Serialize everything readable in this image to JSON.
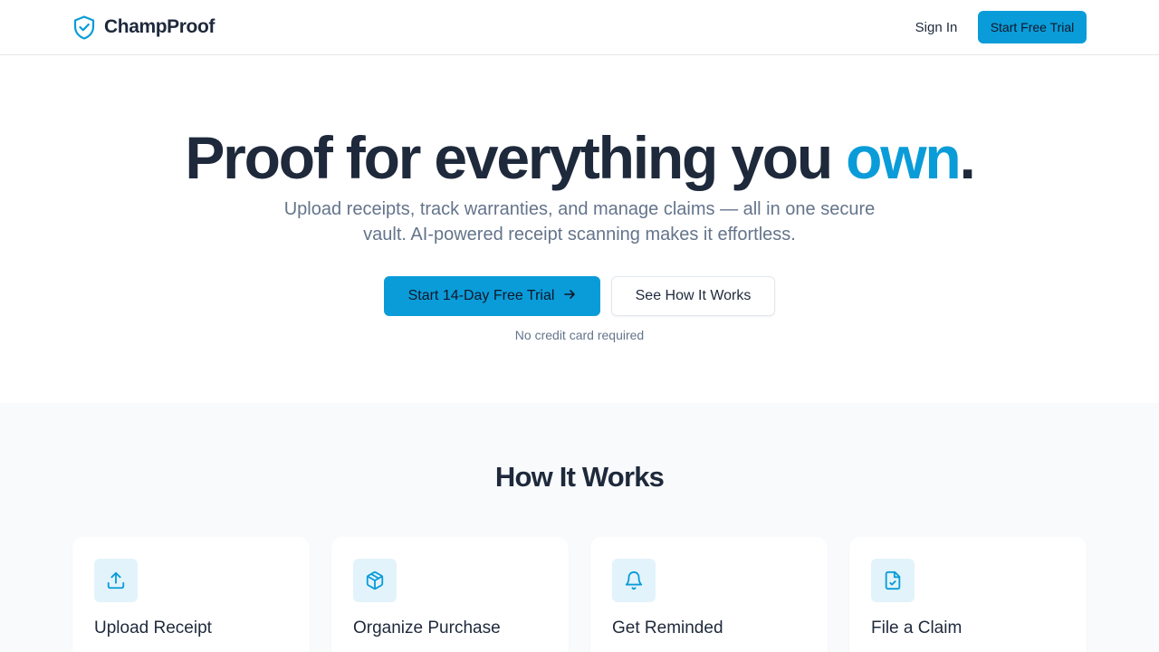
{
  "header": {
    "brand_name": "ChampProof",
    "sign_in_label": "Sign In",
    "cta_label": "Start Free Trial"
  },
  "hero": {
    "title_main": "Proof for everything you ",
    "title_accent": "own",
    "title_end": ".",
    "subtitle": "Upload receipts, track warranties, and manage claims — all in one secure vault. AI-powered receipt scanning makes it effortless.",
    "primary_cta_label": "Start 14-Day Free Trial",
    "secondary_cta_label": "See How It Works",
    "note": "No credit card required"
  },
  "how_it_works": {
    "title": "How It Works",
    "steps": [
      {
        "title": "Upload Receipt",
        "icon": "upload-icon"
      },
      {
        "title": "Organize Purchase",
        "icon": "package-icon"
      },
      {
        "title": "Get Reminded",
        "icon": "bell-icon"
      },
      {
        "title": "File a Claim",
        "icon": "file-check-icon"
      }
    ]
  },
  "colors": {
    "accent": "#0a9cd8",
    "text_dark": "#1e293b",
    "text_muted": "#64748b",
    "section_bg": "#f8fafc",
    "icon_tile_bg": "#e3f3fb"
  }
}
